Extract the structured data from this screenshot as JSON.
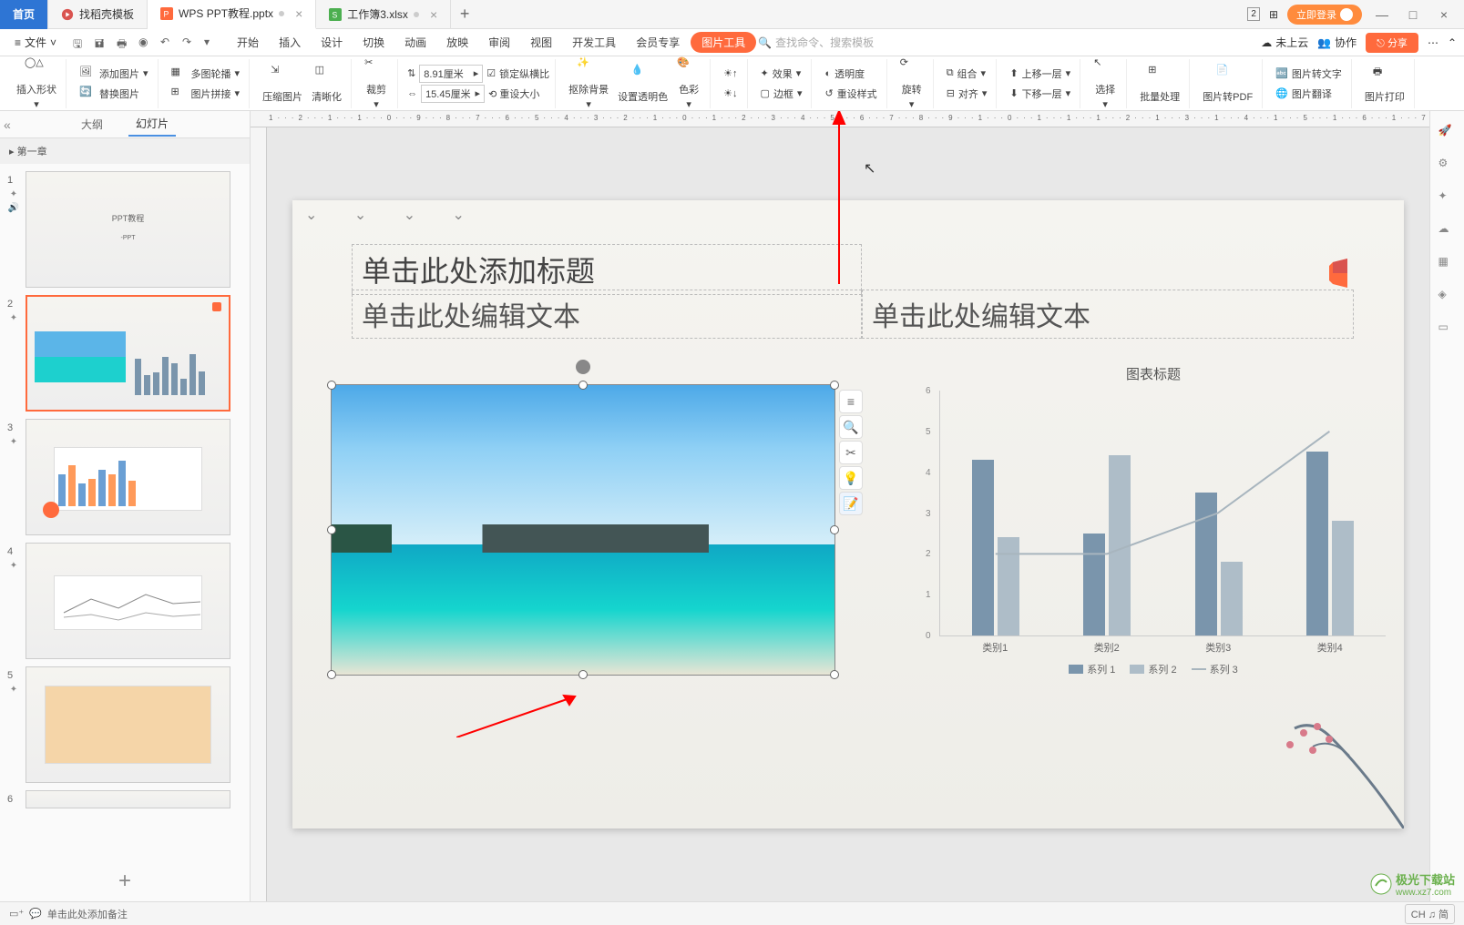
{
  "titlebar": {
    "home": "首页",
    "tabs": [
      {
        "label": "找稻壳模板",
        "icon": "#d9534f"
      },
      {
        "label": "WPS PPT教程.pptx",
        "icon": "#ff6a3d",
        "active": true
      },
      {
        "label": "工作簿3.xlsx",
        "icon": "#4caf50"
      }
    ],
    "login": "立即登录"
  },
  "menubar": {
    "file": "文件",
    "items": [
      "开始",
      "插入",
      "设计",
      "切换",
      "动画",
      "放映",
      "审阅",
      "视图",
      "开发工具",
      "会员专享"
    ],
    "tool": "图片工具",
    "search_placeholder": "查找命令、搜索模板",
    "cloud": "未上云",
    "coop": "协作",
    "share": "分享"
  },
  "ribbon": {
    "insert_shape": "插入形状",
    "add_image": "添加图片",
    "multi_outline": "多图轮播",
    "replace_image": "替换图片",
    "image_stitch": "图片拼接",
    "compress": "压缩图片",
    "sharpen": "清晰化",
    "crop": "裁剪",
    "height": "8.91厘米",
    "width": "15.45厘米",
    "lock_ratio": "锁定纵横比",
    "reset_size": "重设大小",
    "remove_bg": "抠除背景",
    "transparent_color": "设置透明色",
    "color": "色彩",
    "effect": "效果",
    "transparency": "透明度",
    "border": "边框",
    "reset_style": "重设样式",
    "rotate": "旋转",
    "combine": "组合",
    "align": "对齐",
    "move_up": "上移一层",
    "move_down": "下移一层",
    "select": "选择",
    "batch": "批量处理",
    "to_pdf": "图片转PDF",
    "to_text": "图片转文字",
    "translate": "图片翻译",
    "print": "图片打印"
  },
  "leftpanel": {
    "outline": "大纲",
    "slides": "幻灯片",
    "section": "第一章",
    "thumb_nums": [
      "1",
      "2",
      "3",
      "4",
      "5",
      "6"
    ]
  },
  "slide": {
    "title": "单击此处添加标题",
    "text1": "单击此处编辑文本",
    "text2": "单击此处编辑文本"
  },
  "chart_data": {
    "type": "bar+line",
    "title": "图表标题",
    "categories": [
      "类别1",
      "类别2",
      "类别3",
      "类别4"
    ],
    "series": [
      {
        "name": "系列 1",
        "type": "bar",
        "values": [
          4.3,
          2.5,
          3.5,
          4.5
        ],
        "color": "#7a95ac"
      },
      {
        "name": "系列 2",
        "type": "bar",
        "values": [
          2.4,
          4.4,
          1.8,
          2.8
        ],
        "color": "#aebdc8"
      },
      {
        "name": "系列 3",
        "type": "line",
        "values": [
          2.0,
          2.0,
          3.0,
          5.0
        ],
        "color": "#a8b5be"
      }
    ],
    "ylim": [
      0,
      6
    ],
    "yticks": [
      0,
      1,
      2,
      3,
      4,
      5,
      6
    ]
  },
  "statusbar": {
    "notes": "单击此处添加备注",
    "ime": "CH ♫ 简"
  },
  "watermark": {
    "text": "极光下载站",
    "url": "www.xz7.com"
  }
}
